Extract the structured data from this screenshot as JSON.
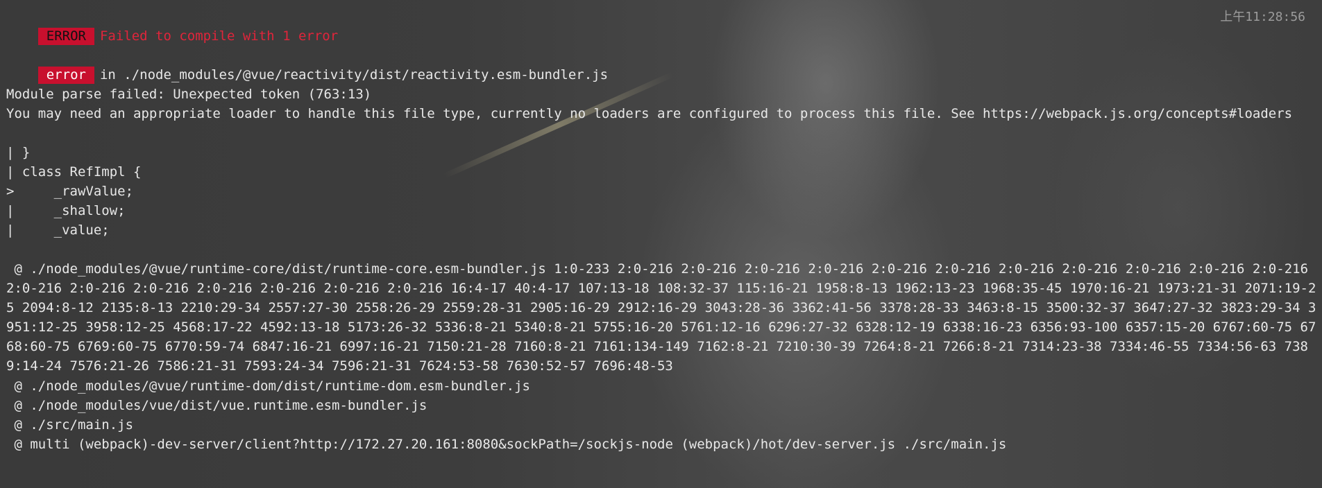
{
  "header": {
    "error_tag": "ERROR",
    "message": "Failed to compile with 1 error",
    "time": "上午11:28:56"
  },
  "file": {
    "tag": "error",
    "path_text": "in ./node_modules/@vue/reactivity/dist/reactivity.esm-bundler.js"
  },
  "details": {
    "line1": "Module parse failed: Unexpected token (763:13)",
    "line2": "You may need an appropriate loader to handle this file type, currently no loaders are configured to process this file. See https://webpack.js.org/concepts#loaders",
    "code": [
      "| }",
      "| class RefImpl {",
      ">     _rawValue;",
      "|     _shallow;",
      "|     _value;"
    ]
  },
  "trace": {
    "runtime_core": " @ ./node_modules/@vue/runtime-core/dist/runtime-core.esm-bundler.js 1:0-233 2:0-216 2:0-216 2:0-216 2:0-216 2:0-216 2:0-216 2:0-216 2:0-216 2:0-216 2:0-216 2:0-216 2:0-216 2:0-216 2:0-216 2:0-216 2:0-216 2:0-216 2:0-216 16:4-17 40:4-17 107:13-18 108:32-37 115:16-21 1958:8-13 1962:13-23 1968:35-45 1970:16-21 1973:21-31 2071:19-25 2094:8-12 2135:8-13 2210:29-34 2557:27-30 2558:26-29 2559:28-31 2905:16-29 2912:16-29 3043:28-36 3362:41-56 3378:28-33 3463:8-15 3500:32-37 3647:27-32 3823:29-34 3951:12-25 3958:12-25 4568:17-22 4592:13-18 5173:26-32 5336:8-21 5340:8-21 5755:16-20 5761:12-16 6296:27-32 6328:12-19 6338:16-23 6356:93-100 6357:15-20 6767:60-75 6768:60-75 6769:60-75 6770:59-74 6847:16-21 6997:16-21 7150:21-28 7160:8-21 7161:134-149 7162:8-21 7210:30-39 7264:8-21 7266:8-21 7314:23-38 7334:46-55 7334:56-63 7389:14-24 7576:21-26 7586:21-31 7593:24-34 7596:21-31 7624:53-58 7630:52-57 7696:48-53",
    "runtime_dom": " @ ./node_modules/@vue/runtime-dom/dist/runtime-dom.esm-bundler.js",
    "vue_runtime": " @ ./node_modules/vue/dist/vue.runtime.esm-bundler.js",
    "main": " @ ./src/main.js",
    "multi": " @ multi (webpack)-dev-server/client?http://172.27.20.161:8080&sockPath=/sockjs-node (webpack)/hot/dev-server.js ./src/main.js"
  },
  "colors": {
    "error_red": "#c8102e",
    "headline_red": "#e0253b",
    "text": "#e8e8e8",
    "muted": "#9c9c9c"
  }
}
